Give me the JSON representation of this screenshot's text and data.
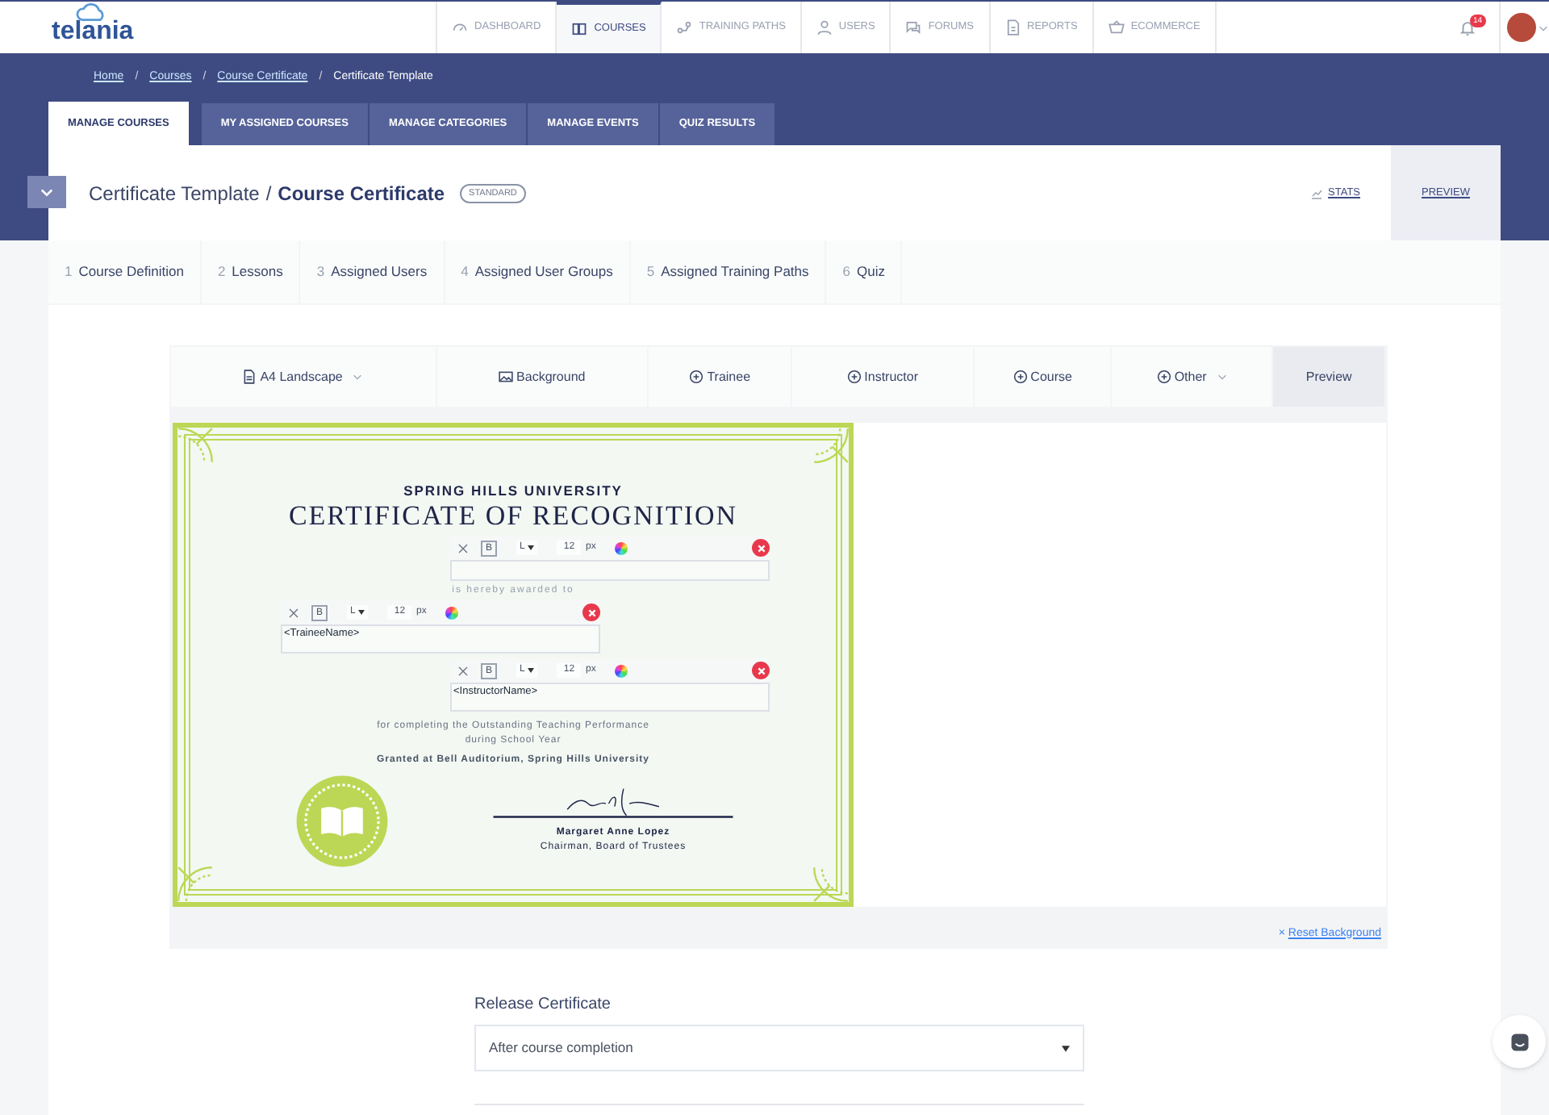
{
  "logo": "telania",
  "nav": [
    {
      "label": "DASHBOARD",
      "selected": false
    },
    {
      "label": "COURSES",
      "selected": true
    },
    {
      "label": "TRAINING PATHS",
      "selected": false
    },
    {
      "label": "USERS",
      "selected": false
    },
    {
      "label": "FORUMS",
      "selected": false
    },
    {
      "label": "REPORTS",
      "selected": false
    },
    {
      "label": "ECOMMERCE",
      "selected": false
    }
  ],
  "notifications": {
    "count": "14"
  },
  "breadcrumb": [
    {
      "label": "Home",
      "link": true
    },
    {
      "separator": "/",
      "label": "Courses",
      "link": true
    },
    {
      "separator": "/",
      "label": "Course Certificate",
      "link": true
    },
    {
      "separator": "/",
      "label": "Certificate Template",
      "link": false
    }
  ],
  "main_tabs": [
    {
      "label": "MANAGE COURSES",
      "selected": true
    },
    {
      "label": "MY ASSIGNED COURSES",
      "selected": false
    },
    {
      "label": "MANAGE CATEGORIES",
      "selected": false
    },
    {
      "label": "MANAGE EVENTS",
      "selected": false
    },
    {
      "label": "QUIZ RESULTS",
      "selected": false
    }
  ],
  "header": {
    "title": "Certificate Template",
    "separator": "/",
    "subtitle": "Course Certificate",
    "badge": "STANDARD",
    "actions": [
      {
        "label": "STATS",
        "kind": "stats",
        "selected": false
      },
      {
        "label": "PREVIEW",
        "kind": "plain",
        "selected": true
      }
    ]
  },
  "steps": [
    {
      "number": "1",
      "label": "Course Definition"
    },
    {
      "number": "2",
      "label": "Lessons"
    },
    {
      "number": "3",
      "label": "Assigned Users"
    },
    {
      "number": "4",
      "label": "Assigned User Groups"
    },
    {
      "number": "5",
      "label": "Assigned Training Paths"
    },
    {
      "number": "6",
      "label": "Quiz"
    }
  ],
  "editor_toolbar": [
    {
      "label": "A4 Landscape",
      "kind": "page",
      "dropdown": true,
      "selected": false
    },
    {
      "label": "Background",
      "kind": "image",
      "dropdown": false,
      "selected": false
    },
    {
      "label": "Trainee",
      "kind": "add",
      "dropdown": false,
      "selected": false
    },
    {
      "label": "Instructor",
      "kind": "add",
      "dropdown": false,
      "selected": false
    },
    {
      "label": "Course",
      "kind": "add",
      "dropdown": false,
      "selected": false
    },
    {
      "label": "Other",
      "kind": "add",
      "dropdown": true,
      "selected": false
    },
    {
      "label": "Preview",
      "kind": "plain",
      "dropdown": false,
      "selected": true
    }
  ],
  "certificate": {
    "university": "SPRING HILLS UNIVERSITY",
    "title": "CERTIFICATE OF RECOGNITION",
    "awarded": "is hereby awarded to",
    "completing": "for completing the Outstanding Teaching Performance",
    "period": "during School Year",
    "granted": "Granted at Bell Auditorium, Spring Hills University",
    "signer": "Margaret Anne Lopez",
    "signer_title": "Chairman, Board of Trustees"
  },
  "text_fields": [
    {
      "bold": "B",
      "align": "L",
      "size": "12",
      "unit": "px"
    },
    {
      "bold": "B",
      "align": "L",
      "size": "12",
      "unit": "px",
      "value": "<TraineeName>"
    },
    {
      "bold": "B",
      "align": "L",
      "size": "12",
      "unit": "px",
      "value": "<InstructorName>"
    }
  ],
  "reset": {
    "icon": "×",
    "label": "Reset Background"
  },
  "release": {
    "label": "Release Certificate",
    "value": "After course completion"
  }
}
